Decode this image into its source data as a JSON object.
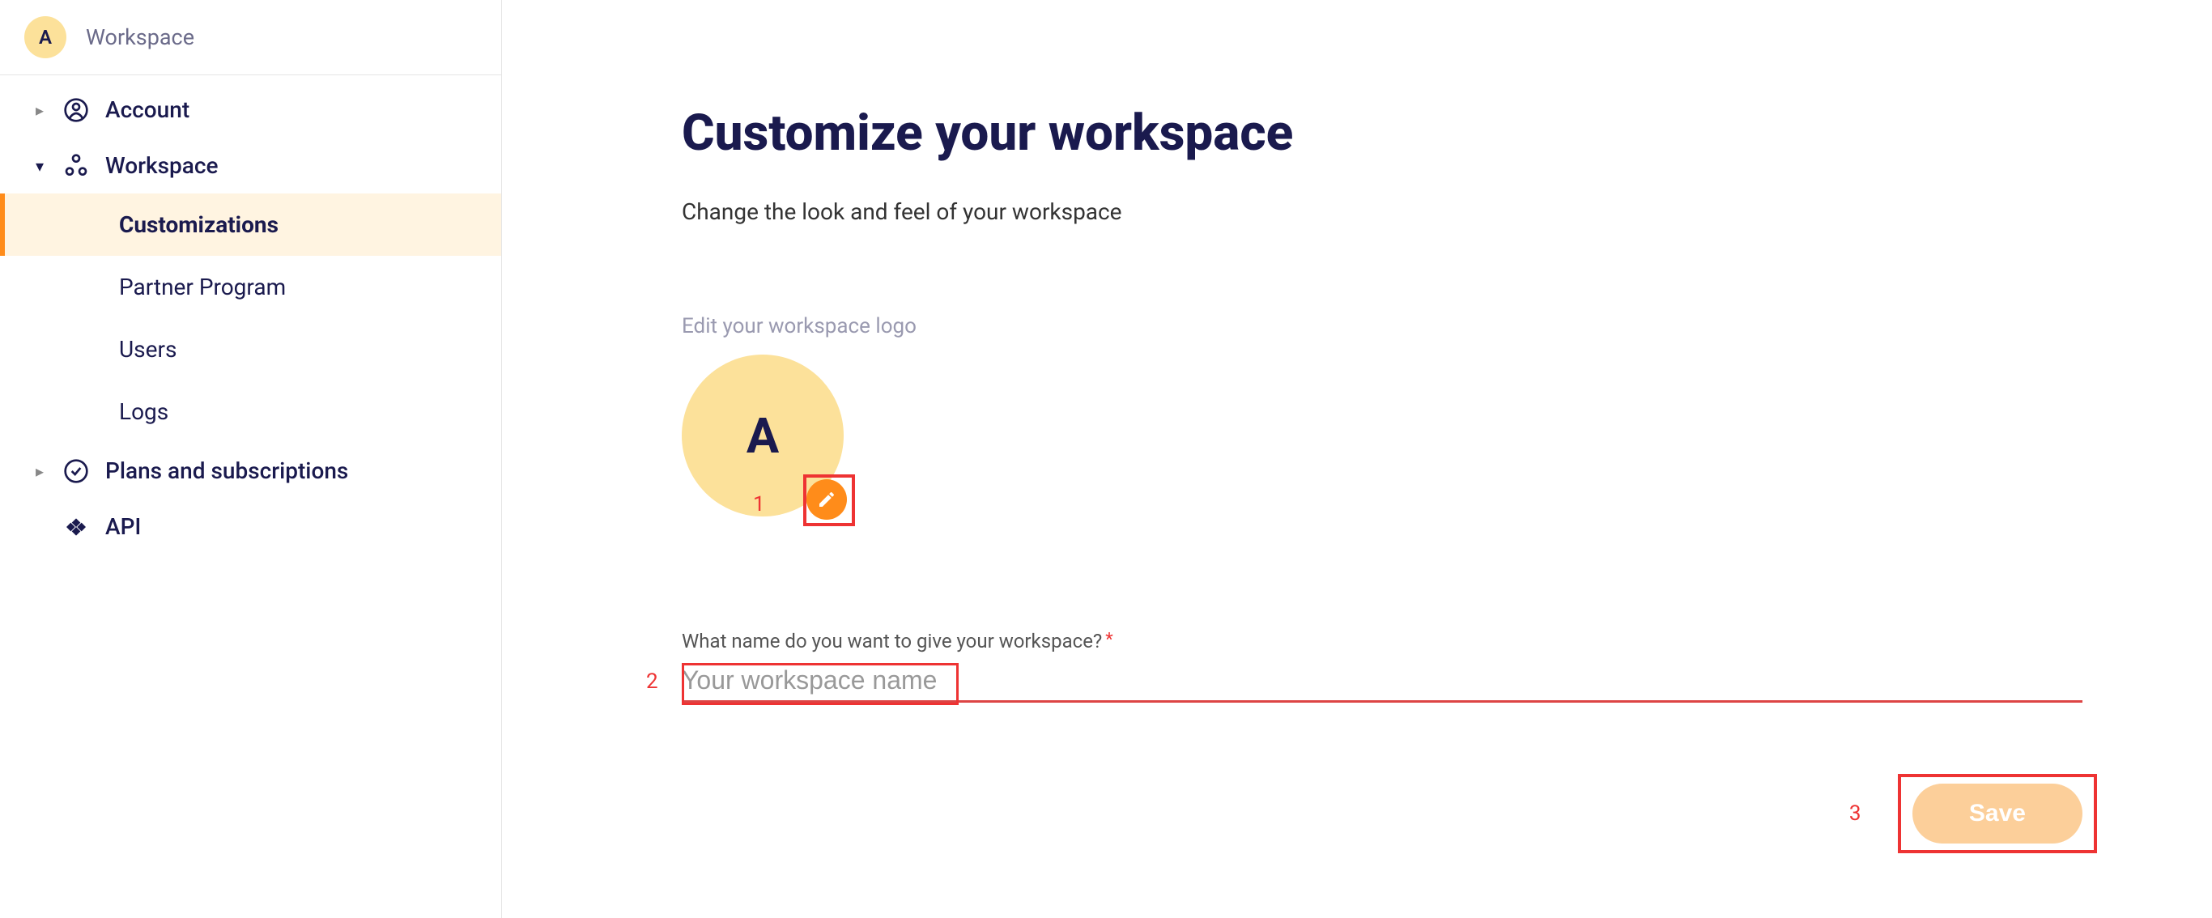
{
  "sidebar": {
    "avatar_letter": "A",
    "workspace_label": "Workspace",
    "items": [
      {
        "label": "Account",
        "icon": "person-circle-icon",
        "expandable": true,
        "expanded": false
      },
      {
        "label": "Workspace",
        "icon": "nodes-icon",
        "expandable": true,
        "expanded": true,
        "children": [
          {
            "label": "Customizations",
            "active": true
          },
          {
            "label": "Partner Program",
            "active": false
          },
          {
            "label": "Users",
            "active": false
          },
          {
            "label": "Logs",
            "active": false
          }
        ]
      },
      {
        "label": "Plans and subscriptions",
        "icon": "check-circle-icon",
        "expandable": true,
        "expanded": false
      },
      {
        "label": "API",
        "icon": "diamond-icon",
        "expandable": false
      }
    ]
  },
  "main": {
    "title": "Customize your workspace",
    "subtitle": "Change the look and feel of your workspace",
    "logo_section_label": "Edit your workspace logo",
    "avatar_letter": "A",
    "name_input_label": "What name do you want to give your workspace?",
    "name_input_placeholder": "Your workspace name",
    "save_button_label": "Save"
  },
  "annotations": {
    "one": "1",
    "two": "2",
    "three": "3"
  }
}
